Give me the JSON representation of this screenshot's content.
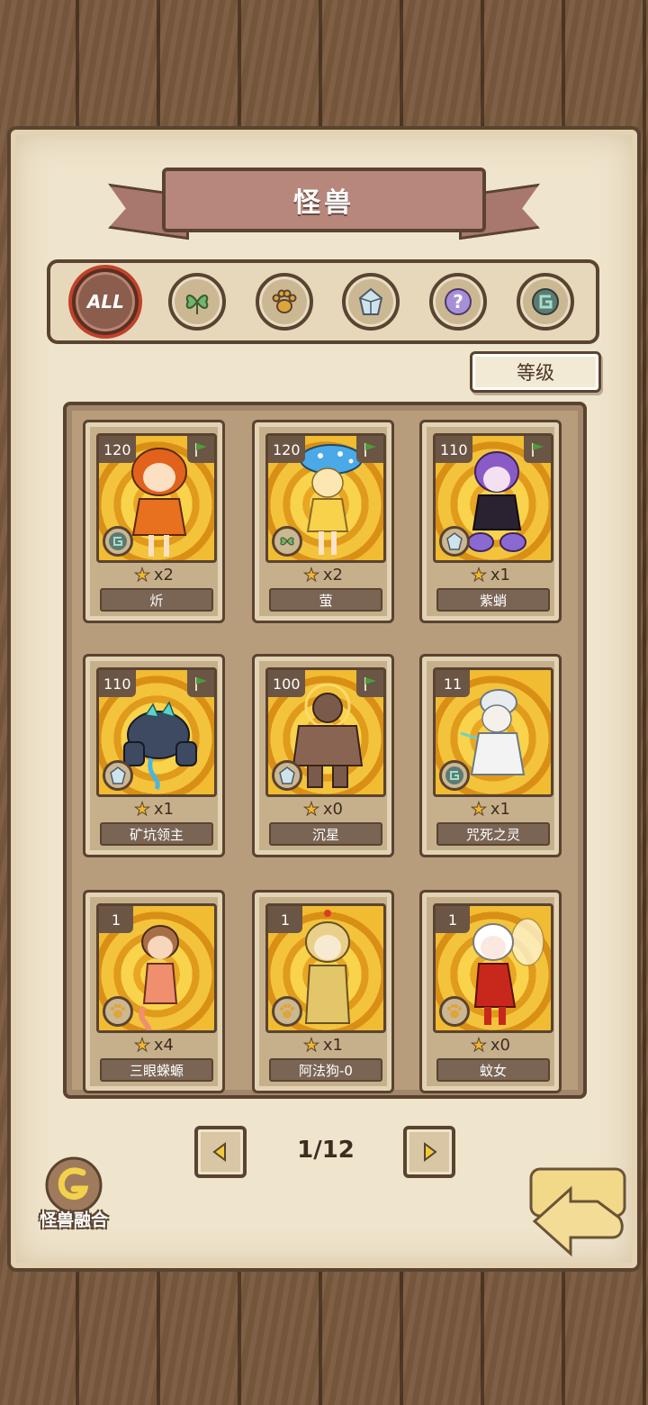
{
  "title": "怪兽",
  "filters": [
    {
      "id": "all",
      "label": "ALL",
      "icon": "all-icon",
      "active": true
    },
    {
      "id": "plant",
      "label": "",
      "icon": "leaf-icon",
      "active": false
    },
    {
      "id": "beast",
      "label": "",
      "icon": "paw-icon",
      "active": false
    },
    {
      "id": "mineral",
      "label": "",
      "icon": "crystal-icon",
      "active": false
    },
    {
      "id": "unknown",
      "label": "",
      "icon": "question-icon",
      "active": false
    },
    {
      "id": "spirit",
      "label": "",
      "icon": "spiral-icon",
      "active": false
    }
  ],
  "sort_label": "等级",
  "cards": [
    {
      "level": "120",
      "count": "x2",
      "name": "炘",
      "type_icon": "spiral-icon",
      "flag": true
    },
    {
      "level": "120",
      "count": "x2",
      "name": "萤",
      "type_icon": "leaf-icon",
      "flag": true
    },
    {
      "level": "110",
      "count": "x1",
      "name": "紫蛸",
      "type_icon": "crystal-icon",
      "flag": true
    },
    {
      "level": "110",
      "count": "x1",
      "name": "矿坑领主",
      "type_icon": "crystal-icon",
      "flag": true
    },
    {
      "level": "100",
      "count": "x0",
      "name": "沉星",
      "type_icon": "crystal-icon",
      "flag": true
    },
    {
      "level": "11",
      "count": "x1",
      "name": "咒死之灵",
      "type_icon": "spiral-icon",
      "flag": false
    },
    {
      "level": "1",
      "count": "x4",
      "name": "三眼蝾螈",
      "type_icon": "paw-icon",
      "flag": false
    },
    {
      "level": "1",
      "count": "x1",
      "name": "阿法狗-0",
      "type_icon": "paw-icon",
      "flag": false
    },
    {
      "level": "1",
      "count": "x0",
      "name": "蚊女",
      "type_icon": "paw-icon",
      "flag": false
    }
  ],
  "pager": {
    "text": "1/12"
  },
  "fusion_label": "怪兽融合",
  "colors": {
    "panel": "#efe4cc",
    "border": "#5a4330",
    "accent_red": "#c1412b",
    "flag_green": "#4f9a3e"
  }
}
